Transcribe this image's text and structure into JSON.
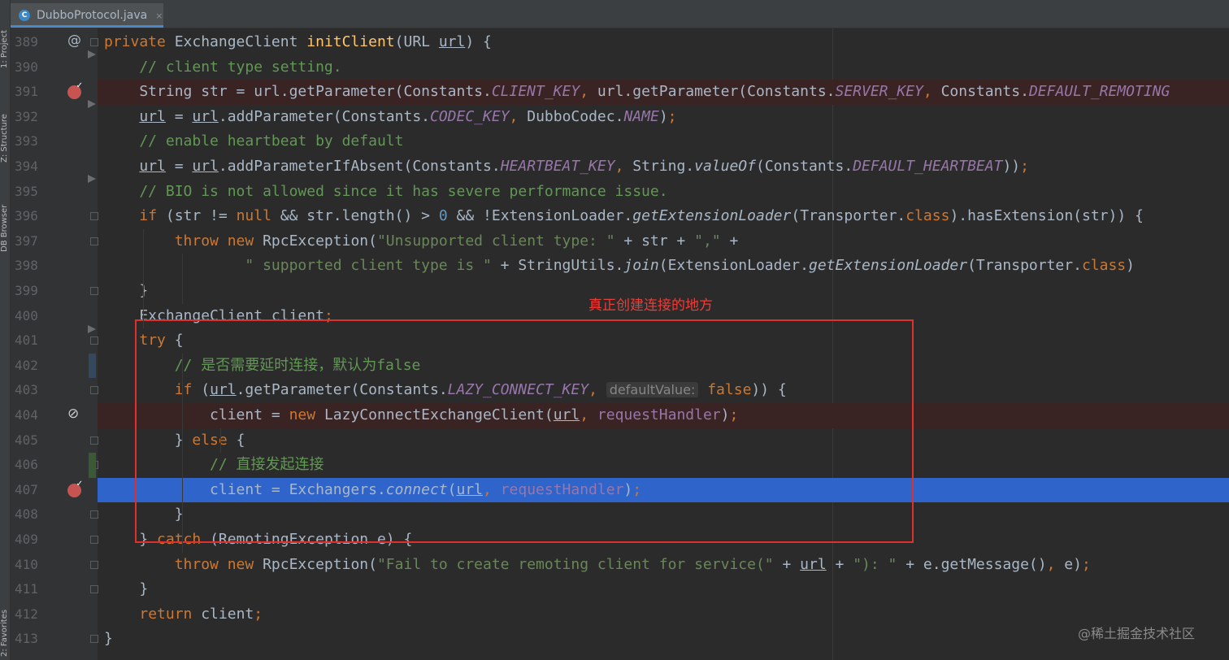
{
  "side_tabs": {
    "project": "1: Project",
    "structure": "Z: Structure",
    "db_browser": "DB Browser",
    "favorites": "2: Favorites"
  },
  "tab": {
    "filename": "DubboProtocol.java",
    "icon_letter": "C",
    "close": "×"
  },
  "gutter_markers": {
    "at_symbol": "@",
    "no_symbol": "⊘"
  },
  "annotation": "真正创建连接的地方",
  "watermark": "@稀土掘金技术社区",
  "lines": [
    {
      "num": "389",
      "segs": [
        [
          "kw",
          "private "
        ],
        [
          "",
          "ExchangeClient "
        ],
        [
          "fn",
          "initClient"
        ],
        [
          "",
          "(URL "
        ],
        [
          "ul",
          "url"
        ],
        [
          "",
          ") {"
        ]
      ]
    },
    {
      "num": "390",
      "segs": [
        [
          "cm",
          "    // client type setting."
        ]
      ]
    },
    {
      "num": "391",
      "segs": [
        [
          "",
          "    String str = url.getParameter(Constants."
        ],
        [
          "cn",
          "CLIENT_KEY"
        ],
        [
          "kw",
          ", "
        ],
        [
          "",
          "url.getParameter(Constants."
        ],
        [
          "cn",
          "SERVER_KEY"
        ],
        [
          "kw",
          ", "
        ],
        [
          "",
          "Constants."
        ],
        [
          "cn",
          "DEFAULT_REMOTING"
        ]
      ]
    },
    {
      "num": "392",
      "segs": [
        [
          "",
          "    "
        ],
        [
          "ul",
          "url"
        ],
        [
          "",
          " = "
        ],
        [
          "ul",
          "url"
        ],
        [
          "",
          ".addParameter(Constants."
        ],
        [
          "cn",
          "CODEC_KEY"
        ],
        [
          "kw",
          ", "
        ],
        [
          "",
          "DubboCodec."
        ],
        [
          "cn",
          "NAME"
        ],
        [
          "",
          ")"
        ],
        [
          "kw",
          ";"
        ]
      ]
    },
    {
      "num": "393",
      "segs": [
        [
          "cm",
          "    // enable heartbeat by default"
        ]
      ]
    },
    {
      "num": "394",
      "segs": [
        [
          "",
          "    "
        ],
        [
          "ul",
          "url"
        ],
        [
          "",
          " = "
        ],
        [
          "ul",
          "url"
        ],
        [
          "",
          ".addParameterIfAbsent(Constants."
        ],
        [
          "cn",
          "HEARTBEAT_KEY"
        ],
        [
          "kw",
          ", "
        ],
        [
          "",
          "String."
        ],
        [
          "it",
          "valueOf"
        ],
        [
          "",
          "(Constants."
        ],
        [
          "cn",
          "DEFAULT_HEARTBEAT"
        ],
        [
          "",
          "))"
        ],
        [
          "kw",
          ";"
        ]
      ]
    },
    {
      "num": "395",
      "segs": [
        [
          "cm",
          "    // BIO is not allowed since it has severe performance issue."
        ]
      ]
    },
    {
      "num": "396",
      "segs": [
        [
          "",
          "    "
        ],
        [
          "kw",
          "if "
        ],
        [
          "",
          "(str != "
        ],
        [
          "kw",
          "null "
        ],
        [
          "",
          "&& str.length() > "
        ],
        [
          "nm",
          "0 "
        ],
        [
          "",
          "&& !ExtensionLoader."
        ],
        [
          "it",
          "getExtensionLoader"
        ],
        [
          "",
          "(Transporter."
        ],
        [
          "kw",
          "class"
        ],
        [
          "",
          ").hasExtension(str)) {"
        ]
      ]
    },
    {
      "num": "397",
      "segs": [
        [
          "",
          "        "
        ],
        [
          "kw",
          "throw new "
        ],
        [
          "",
          "RpcException("
        ],
        [
          "st",
          "\"Unsupported client type: \" "
        ],
        [
          "",
          "+ str + "
        ],
        [
          "st",
          "\",\" "
        ],
        [
          "",
          "+"
        ]
      ]
    },
    {
      "num": "398",
      "segs": [
        [
          "",
          "                "
        ],
        [
          "st",
          "\" supported client type is \" "
        ],
        [
          "",
          "+ StringUtils."
        ],
        [
          "it",
          "join"
        ],
        [
          "",
          "(ExtensionLoader."
        ],
        [
          "it",
          "getExtensionLoader"
        ],
        [
          "",
          "(Transporter."
        ],
        [
          "kw",
          "class"
        ],
        [
          "",
          ")"
        ]
      ]
    },
    {
      "num": "399",
      "segs": [
        [
          "",
          "    }"
        ]
      ]
    },
    {
      "num": "400",
      "segs": [
        [
          "",
          "    ExchangeClient client"
        ],
        [
          "kw",
          ";"
        ]
      ]
    },
    {
      "num": "401",
      "segs": [
        [
          "",
          "    "
        ],
        [
          "kw",
          "try "
        ],
        [
          "",
          "{"
        ]
      ]
    },
    {
      "num": "402",
      "segs": [
        [
          "cm",
          "        // 是否需要延时连接，默认为false"
        ]
      ]
    },
    {
      "num": "403",
      "segs": [
        [
          "",
          "        "
        ],
        [
          "kw",
          "if "
        ],
        [
          "",
          "("
        ],
        [
          "ul",
          "url"
        ],
        [
          "",
          ".getParameter(Constants."
        ],
        [
          "cn",
          "LAZY_CONNECT_KEY"
        ],
        [
          "kw",
          ", "
        ],
        [
          "hint",
          "defaultValue:"
        ],
        [
          "",
          " "
        ],
        [
          "kw",
          "false"
        ],
        [
          "",
          ")) {"
        ]
      ]
    },
    {
      "num": "404",
      "segs": [
        [
          "",
          "            client = "
        ],
        [
          "kw",
          "new "
        ],
        [
          "",
          "LazyConnectExchangeClient("
        ],
        [
          "ul",
          "url"
        ],
        [
          "kw",
          ", "
        ],
        [
          "fd",
          "requestHandler"
        ],
        [
          "",
          ")"
        ],
        [
          "kw",
          ";"
        ]
      ]
    },
    {
      "num": "405",
      "segs": [
        [
          "",
          "        } "
        ],
        [
          "kw",
          "else "
        ],
        [
          "",
          "{"
        ]
      ]
    },
    {
      "num": "406",
      "segs": [
        [
          "cm",
          "            // 直接发起连接"
        ]
      ]
    },
    {
      "num": "407",
      "segs": [
        [
          "",
          "            client = Exchangers."
        ],
        [
          "it",
          "connect"
        ],
        [
          "",
          "("
        ],
        [
          "ul",
          "url"
        ],
        [
          "kw",
          ", "
        ],
        [
          "fd",
          "requestHandler"
        ],
        [
          "",
          ")"
        ],
        [
          "kw",
          ";"
        ]
      ]
    },
    {
      "num": "408",
      "segs": [
        [
          "",
          "        }"
        ]
      ]
    },
    {
      "num": "409",
      "segs": [
        [
          "",
          "    } "
        ],
        [
          "kw",
          "catch "
        ],
        [
          "",
          "(RemotingException e) {"
        ]
      ]
    },
    {
      "num": "410",
      "segs": [
        [
          "",
          "        "
        ],
        [
          "kw",
          "throw new "
        ],
        [
          "",
          "RpcException("
        ],
        [
          "st",
          "\"Fail to create remoting client for service(\" "
        ],
        [
          "",
          "+ "
        ],
        [
          "ul",
          "url"
        ],
        [
          "",
          " + "
        ],
        [
          "st",
          "\"): \" "
        ],
        [
          "",
          "+ e.getMessage()"
        ],
        [
          "kw",
          ", "
        ],
        [
          "",
          "e)"
        ],
        [
          "kw",
          ";"
        ]
      ]
    },
    {
      "num": "411",
      "segs": [
        [
          "",
          "    }"
        ]
      ]
    },
    {
      "num": "412",
      "segs": [
        [
          "",
          "    "
        ],
        [
          "kw",
          "return "
        ],
        [
          "",
          "client"
        ],
        [
          "kw",
          ";"
        ]
      ]
    },
    {
      "num": "413",
      "segs": [
        [
          "",
          "}"
        ]
      ]
    }
  ]
}
